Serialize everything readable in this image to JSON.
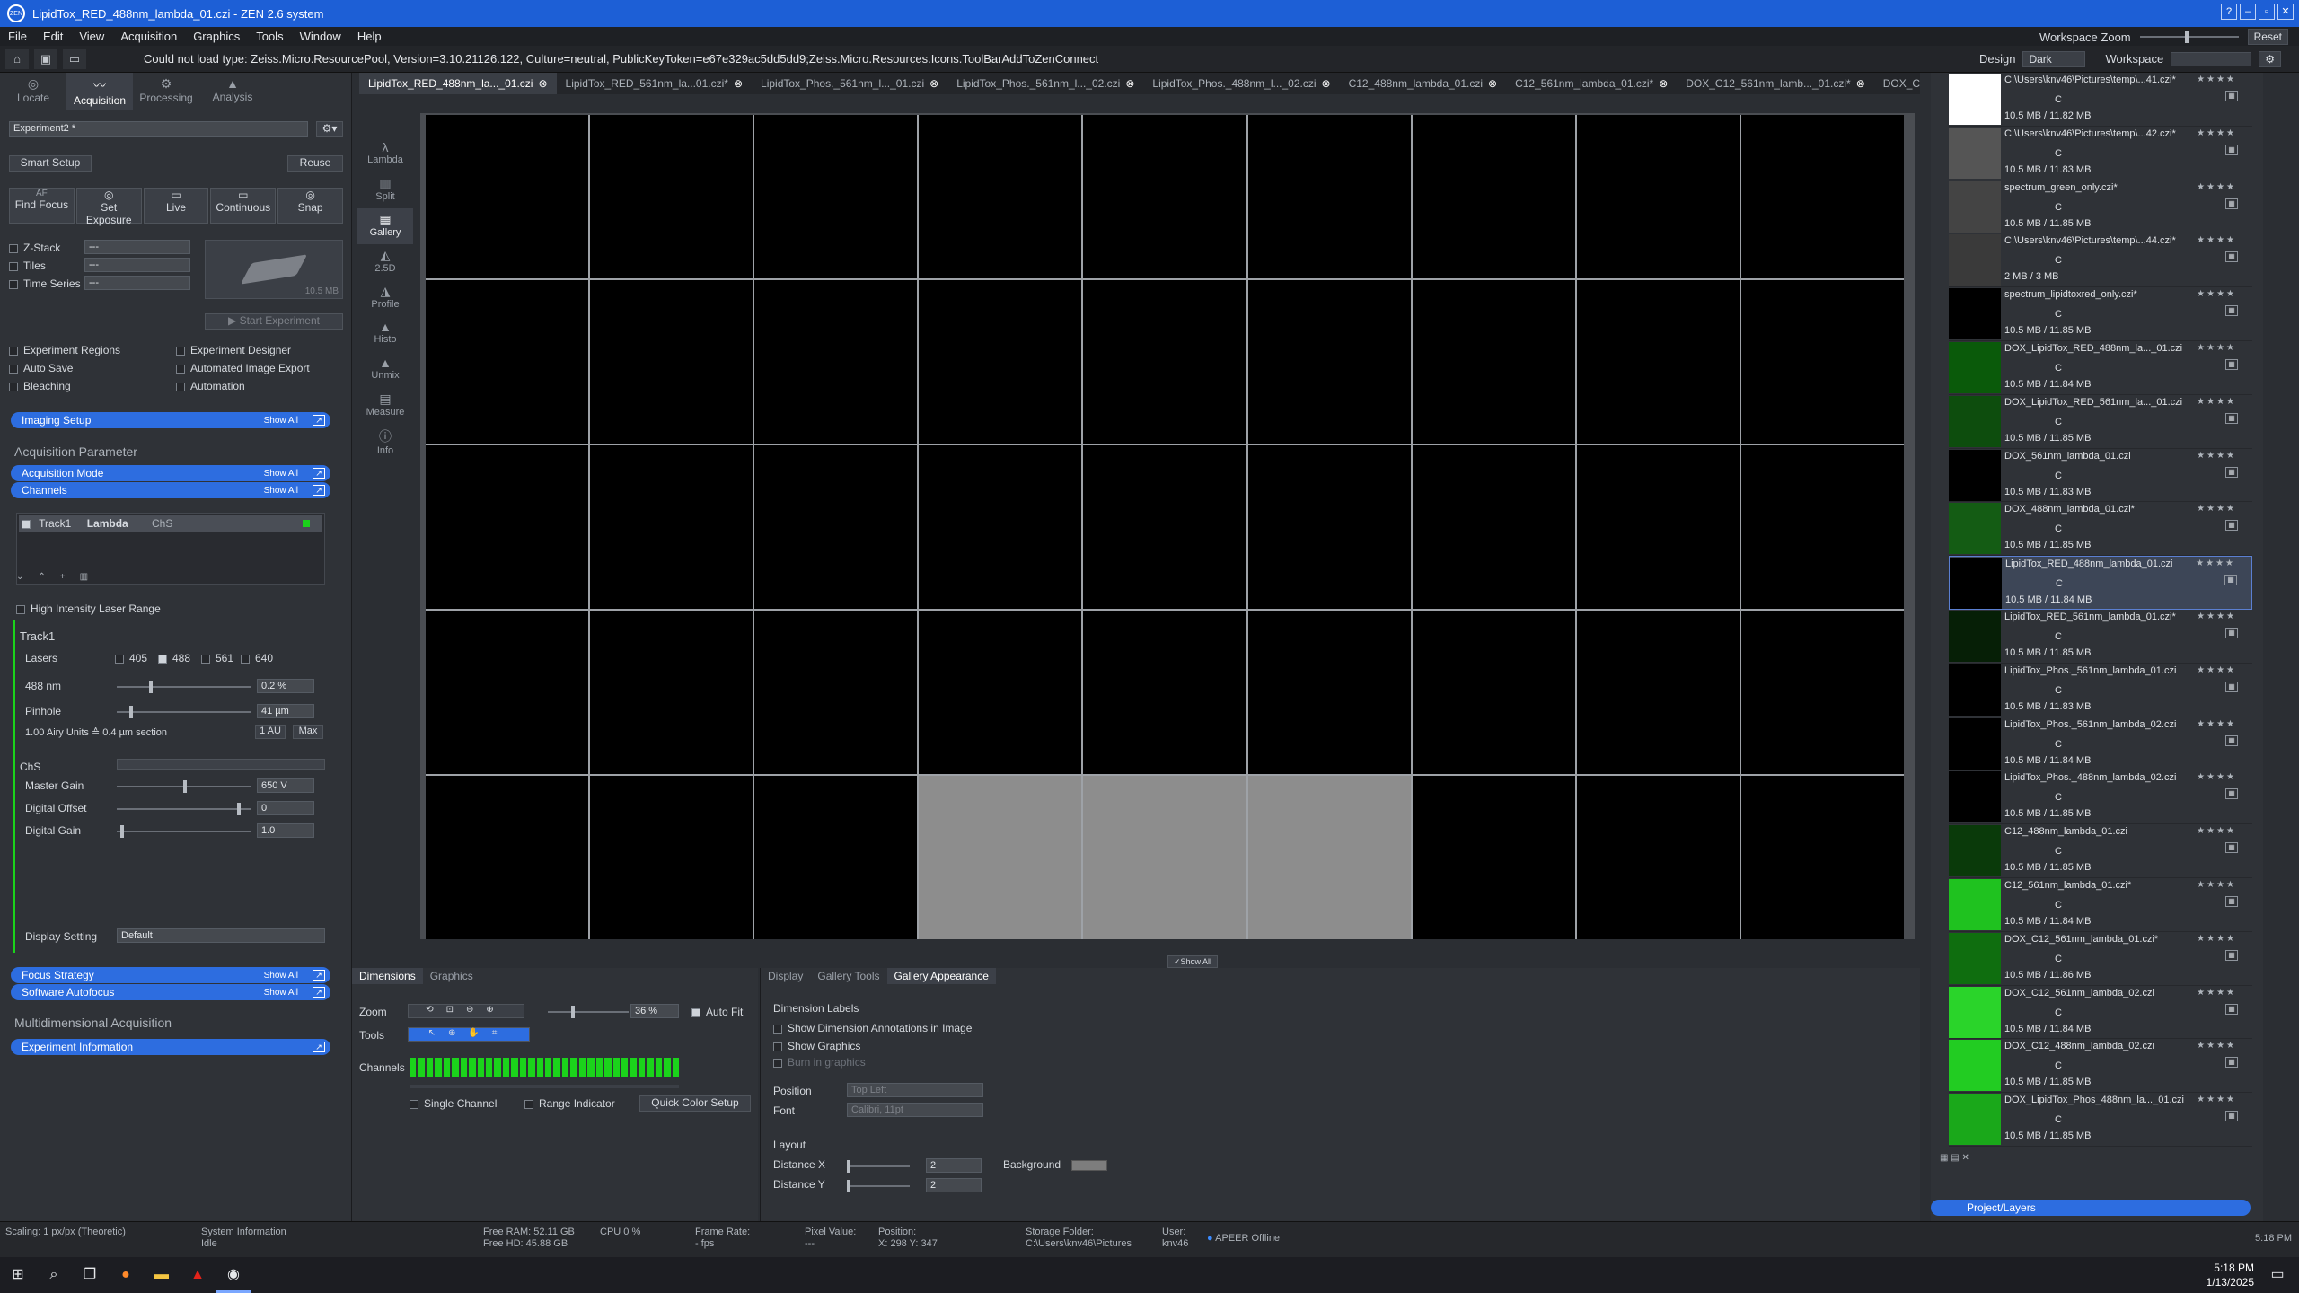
{
  "window": {
    "title": "LipidTox_RED_488nm_lambda_01.czi - ZEN 2.6 system",
    "logo": "ZEN"
  },
  "menu": [
    "File",
    "Edit",
    "View",
    "Acquisition",
    "Graphics",
    "Tools",
    "Window",
    "Help"
  ],
  "workspace_zoom": {
    "label": "Workspace Zoom",
    "reset": "Reset"
  },
  "infobar": {
    "message": "Could not load type: Zeiss.Micro.ResourcePool, Version=3.10.21126.122, Culture=neutral, PublicKeyToken=e67e329ac5dd5dd9;Zeiss.Micro.Resources.Icons.ToolBarAddToZenConnect",
    "design_label": "Design",
    "design_value": "Dark",
    "workspace_label": "Workspace"
  },
  "modes": [
    {
      "label": "Locate",
      "icon": "locate-icon"
    },
    {
      "label": "Acquisition",
      "icon": "acquisition-icon"
    },
    {
      "label": "Processing",
      "icon": "processing-icon"
    },
    {
      "label": "Analysis",
      "icon": "analysis-icon"
    }
  ],
  "experiment": {
    "name": "Experiment2 *",
    "smart_setup": "Smart Setup",
    "reuse": "Reuse"
  },
  "acq_buttons": [
    {
      "label": "Find Focus",
      "icon": "AF"
    },
    {
      "label": "Set Exposure",
      "icon": "◎"
    },
    {
      "label": "Live",
      "icon": "▭"
    },
    {
      "label": "Continuous",
      "icon": "▭"
    },
    {
      "label": "Snap",
      "icon": "◎"
    }
  ],
  "dims": [
    {
      "label": "Z-Stack",
      "value": "---"
    },
    {
      "label": "Tiles",
      "value": "---"
    },
    {
      "label": "Time Series",
      "value": "---"
    }
  ],
  "preview": {
    "size": "10.5 MB",
    "start": "Start Experiment"
  },
  "options_left": [
    "Experiment Regions",
    "Auto Save",
    "Bleaching"
  ],
  "options_right": [
    "Experiment Designer",
    "Automated Image Export",
    "Automation"
  ],
  "sections": {
    "imaging_setup": "Imaging Setup",
    "show_all": "Show All",
    "acq_param": "Acquisition Parameter",
    "acq_mode": "Acquisition Mode",
    "channels": "Channels",
    "focus_strategy": "Focus Strategy",
    "software_autofocus": "Software Autofocus",
    "multidim": "Multidimensional Acquisition",
    "exp_info": "Experiment Information"
  },
  "track": {
    "name": "Track1",
    "mode": "Lambda",
    "channel": "ChS"
  },
  "hi_laser": "High Intensity Laser Range",
  "track_title": "Track1",
  "lasers": {
    "label": "Lasers",
    "options": [
      "405",
      "488",
      "561",
      "640"
    ],
    "checked": "488"
  },
  "laser488": {
    "label": "488 nm",
    "value": "0.2 %"
  },
  "pinhole": {
    "label": "Pinhole",
    "value": "41 µm",
    "airy": "1.00 Airy Units ≙ 0.4 µm section",
    "au": "1 AU",
    "max": "Max"
  },
  "chs": {
    "label": "ChS",
    "master_gain_label": "Master Gain",
    "master_gain": "650 V",
    "offset_label": "Digital Offset",
    "offset": "0",
    "dgain_label": "Digital Gain",
    "dgain": "1.0",
    "display_label": "Display Setting",
    "display": "Default"
  },
  "view_tools": [
    {
      "label": "Lambda",
      "icon": "λ"
    },
    {
      "label": "Split",
      "icon": "▥"
    },
    {
      "label": "Gallery",
      "icon": "▦"
    },
    {
      "label": "2.5D",
      "icon": "◭"
    },
    {
      "label": "Profile",
      "icon": "◮"
    },
    {
      "label": "Histo",
      "icon": "▲"
    },
    {
      "label": "Unmix",
      "icon": "▲"
    },
    {
      "label": "Measure",
      "icon": "▤"
    },
    {
      "label": "Info",
      "icon": "ⓘ"
    }
  ],
  "doc_tabs": [
    "LipidTox_RED_488nm_la..._01.czi",
    "LipidTox_RED_561nm_la...01.czi*",
    "LipidTox_Phos._561nm_l..._01.czi",
    "LipidTox_Phos._561nm_l..._02.czi",
    "LipidTox_Phos._488nm_l..._02.czi",
    "C12_488nm_lambda_01.czi",
    "C12_561nm_lambda_01.czi*",
    "DOX_C12_561nm_lamb..._01.czi*",
    "DOX_C"
  ],
  "gallery": {
    "gray_cells": [
      39,
      40,
      41
    ],
    "show_all": "Show All"
  },
  "bottom_tabs": {
    "left": [
      "Dimensions",
      "Graphics"
    ],
    "right": [
      "Display",
      "Gallery Tools",
      "Gallery Appearance"
    ]
  },
  "zoom": {
    "label": "Zoom",
    "value": "36 %",
    "autofit": "Auto Fit",
    "tools_label": "Tools",
    "channels_label": "Channels",
    "single": "Single Channel",
    "range": "Range Indicator",
    "quick": "Quick Color Setup"
  },
  "appearance": {
    "dim_labels": "Dimension Labels",
    "show_dim": "Show Dimension Annotations in Image",
    "show_graphics": "Show Graphics",
    "burn": "Burn in graphics",
    "position_label": "Position",
    "position": "Top Left",
    "font_label": "Font",
    "font": "Calibri, 11pt",
    "layout": "Layout",
    "dx_label": "Distance X",
    "dx": "2",
    "dy_label": "Distance Y",
    "dy": "2",
    "bg_label": "Background"
  },
  "files": [
    {
      "name": "C:\\Users\\knv46\\Pictures\\temp\\...41.czi*",
      "c": "C",
      "size": "10.5 MB / 11.82 MB",
      "thumb": "#ffffff"
    },
    {
      "name": "C:\\Users\\knv46\\Pictures\\temp\\...42.czi*",
      "c": "C",
      "size": "10.5 MB / 11.83 MB",
      "thumb": "#555555"
    },
    {
      "name": "spectrum_green_only.czi*",
      "c": "C",
      "size": "10.5 MB / 11.85 MB",
      "thumb": "#444444"
    },
    {
      "name": "C:\\Users\\knv46\\Pictures\\temp\\...44.czi*",
      "c": "C",
      "size": "2 MB / 3 MB",
      "thumb": "#3a3a3a"
    },
    {
      "name": "spectrum_lipidtoxred_only.czi*",
      "c": "C",
      "size": "10.5 MB / 11.85 MB",
      "thumb": "#000000"
    },
    {
      "name": "DOX_LipidTox_RED_488nm_la..._01.czi",
      "c": "C",
      "size": "10.5 MB / 11.84 MB",
      "thumb": "#0a5a0a"
    },
    {
      "name": "DOX_LipidTox_RED_561nm_la..._01.czi",
      "c": "C",
      "size": "10.5 MB / 11.85 MB",
      "thumb": "#0d4d0d"
    },
    {
      "name": "DOX_561nm_lambda_01.czi",
      "c": "C",
      "size": "10.5 MB / 11.83 MB",
      "thumb": "#000000"
    },
    {
      "name": "DOX_488nm_lambda_01.czi*",
      "c": "C",
      "size": "10.5 MB / 11.85 MB",
      "thumb": "#145c14"
    },
    {
      "name": "LipidTox_RED_488nm_lambda_01.czi",
      "c": "C",
      "size": "10.5 MB / 11.84 MB",
      "thumb": "#000000",
      "selected": true
    },
    {
      "name": "LipidTox_RED_561nm_lambda_01.czi*",
      "c": "C",
      "size": "10.5 MB / 11.85 MB",
      "thumb": "#061f06"
    },
    {
      "name": "LipidTox_Phos._561nm_lambda_01.czi",
      "c": "C",
      "size": "10.5 MB / 11.83 MB",
      "thumb": "#000000"
    },
    {
      "name": "LipidTox_Phos._561nm_lambda_02.czi",
      "c": "C",
      "size": "10.5 MB / 11.84 MB",
      "thumb": "#000000"
    },
    {
      "name": "LipidTox_Phos._488nm_lambda_02.czi",
      "c": "C",
      "size": "10.5 MB / 11.85 MB",
      "thumb": "#000000"
    },
    {
      "name": "C12_488nm_lambda_01.czi",
      "c": "C",
      "size": "10.5 MB / 11.85 MB",
      "thumb": "#0a3a0a"
    },
    {
      "name": "C12_561nm_lambda_01.czi*",
      "c": "C",
      "size": "10.5 MB / 11.84 MB",
      "thumb": "#1fc21f"
    },
    {
      "name": "DOX_C12_561nm_lambda_01.czi*",
      "c": "C",
      "size": "10.5 MB / 11.86 MB",
      "thumb": "#0f6e0f"
    },
    {
      "name": "DOX_C12_561nm_lambda_02.czi",
      "c": "C",
      "size": "10.5 MB / 11.84 MB",
      "thumb": "#2ad42a"
    },
    {
      "name": "DOX_C12_488nm_lambda_02.czi",
      "c": "C",
      "size": "10.5 MB / 11.85 MB",
      "thumb": "#22cc22"
    },
    {
      "name": "DOX_LipidTox_Phos_488nm_la..._01.czi",
      "c": "C",
      "size": "10.5 MB / 11.85 MB",
      "thumb": "#1aa81a"
    }
  ],
  "project_layers": "Project/Layers",
  "status": {
    "scaling": "Scaling: 1 px/px (Theoretic)",
    "sysinfo": "System Information",
    "sysstate": "Idle",
    "ram": "Free RAM: 52.11 GB",
    "hd": "Free HD: 45.88 GB",
    "cpu": "CPU 0 %",
    "frame": "Frame Rate:",
    "fps": "- fps",
    "pixel": "Pixel Value:",
    "pixelv": "---",
    "position": "Position:",
    "posv": "X: 298  Y: 347",
    "storage": "Storage Folder:",
    "storagev": "C:\\Users\\knv46\\Pictures",
    "user": "User:",
    "userv": "knv46",
    "apeer": "APEER Offline",
    "time": "5:18 PM"
  },
  "taskbar": {
    "time": "5:18 PM",
    "date": "1/13/2025"
  }
}
